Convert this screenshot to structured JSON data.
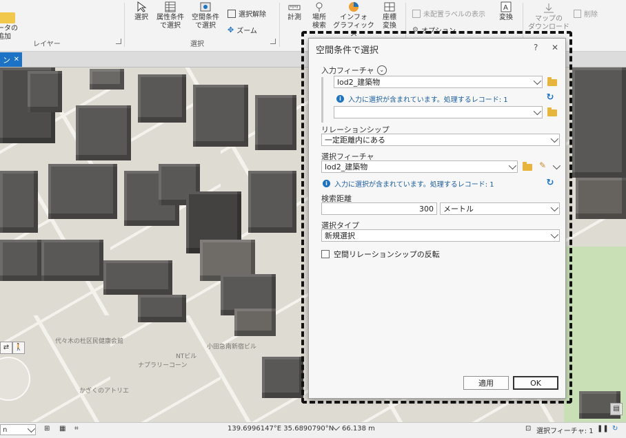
{
  "ribbon": {
    "layer_group": {
      "add_data_label_1": "ータの",
      "add_data_label_2": "追加",
      "group_label": "レイヤー"
    },
    "selection_group": {
      "select_label": "選択",
      "select_by_attr_1": "属性条件",
      "select_by_attr_2": "で選択",
      "select_by_loc_1": "空間条件",
      "select_by_loc_2": "で選択",
      "clear_label": "選択解除",
      "zoom_label": "ズーム",
      "group_label": "選択"
    },
    "inquiry_group": {
      "measure_label": "計測",
      "locate_1": "場所",
      "locate_2": "検索",
      "infographics_1": "インフォ",
      "infographics_2": "グラフィックス",
      "coords_1": "座標",
      "coords_2": "変換"
    },
    "labeling_group": {
      "unplaced_label": "未配置ラベルの表示",
      "options_label": "オプション",
      "convert_label": "変換"
    },
    "offline_group": {
      "download_1": "マップの",
      "download_2": "ダウンロード",
      "delete_label": "削除"
    }
  },
  "map_tab": {
    "label": "ン",
    "close": "✕"
  },
  "map_labels": {
    "shrine": "代々木の杜区民健康会館",
    "alley": "ナプラリーコーン",
    "nt_bldg": "NTビル",
    "odakyu": "小田急南新宿ビル",
    "atelier": "かぎくのアトリエ"
  },
  "status": {
    "scale": "n",
    "coords": "139.6996147°E 35.6890790°N",
    "altitude": "66.138 m",
    "selected_features": "選択フィーチャ: 1"
  },
  "dialog": {
    "title": "空間条件で選択",
    "help": "?",
    "close": "✕",
    "input_features_label": "入力フィーチャ",
    "input_feature_value": "lod2_建築物",
    "input_notice": "入力に選択が含まれています。処理するレコード: 1",
    "input_feature_value_2": "",
    "relationship_label": "リレーションシップ",
    "relationship_value": "一定距離内にある",
    "selecting_features_label": "選択フィーチャ",
    "selecting_feature_value": "lod2_建築物",
    "selecting_notice": "入力に選択が含まれています。処理するレコード: 1",
    "search_distance_label": "検索距離",
    "search_distance_value": "300",
    "search_distance_unit": "メートル",
    "selection_type_label": "選択タイプ",
    "selection_type_value": "新規選択",
    "invert_label": "空間リレーションシップの反転",
    "apply_label": "適用",
    "ok_label": "OK"
  },
  "colors": {
    "accent": "#1c72c4",
    "folder": "#e8b53c",
    "park": "#c9e0b6"
  }
}
